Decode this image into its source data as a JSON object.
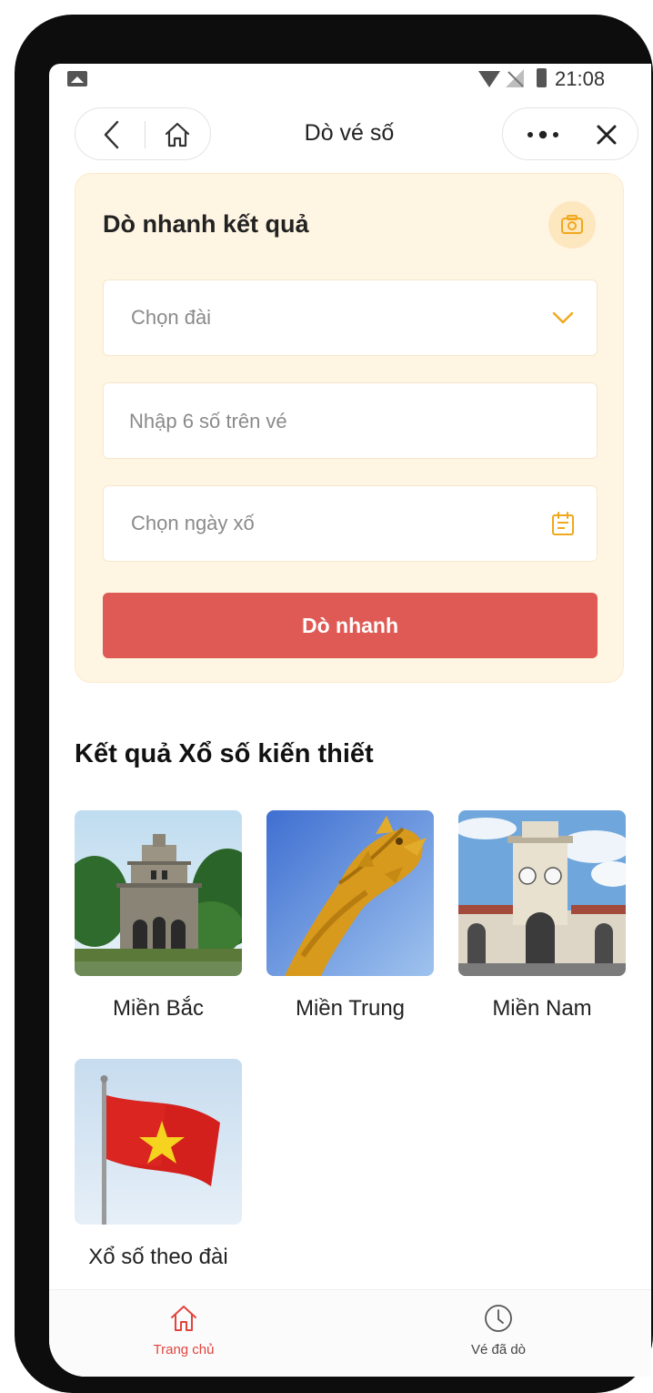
{
  "status_bar": {
    "time": "21:08"
  },
  "navbar": {
    "title": "Dò vé số"
  },
  "quick_check": {
    "title": "Dò nhanh kết quả",
    "station_select": {
      "placeholder": "Chọn đài"
    },
    "ticket_input": {
      "placeholder": "Nhập 6 số trên vé",
      "value": ""
    },
    "date_select": {
      "placeholder": "Chọn ngày xố"
    },
    "submit_label": "Dò nhanh"
  },
  "results": {
    "title": "Kết quả Xổ số kiến thiết",
    "tiles": [
      {
        "label": "Miền Bắc"
      },
      {
        "label": "Miền Trung"
      },
      {
        "label": "Miền Nam"
      },
      {
        "label": "Xổ số theo đài"
      }
    ]
  },
  "tabbar": {
    "tabs": [
      {
        "label": "Trang chủ",
        "active": true
      },
      {
        "label": "Vé đã dò",
        "active": false
      }
    ]
  },
  "colors": {
    "accent": "#e05a55",
    "card_background": "#fff5e3",
    "icon_orange": "#f0a81c",
    "tab_active": "#e0443e",
    "tab_inactive": "#555555"
  },
  "icons": {
    "back": "chevron-left-icon",
    "home": "home-icon",
    "more": "more-dots-icon",
    "close": "close-icon",
    "camera": "camera-icon",
    "dropdown": "chevron-down-icon",
    "calendar": "calendar-icon",
    "history": "clock-icon"
  }
}
